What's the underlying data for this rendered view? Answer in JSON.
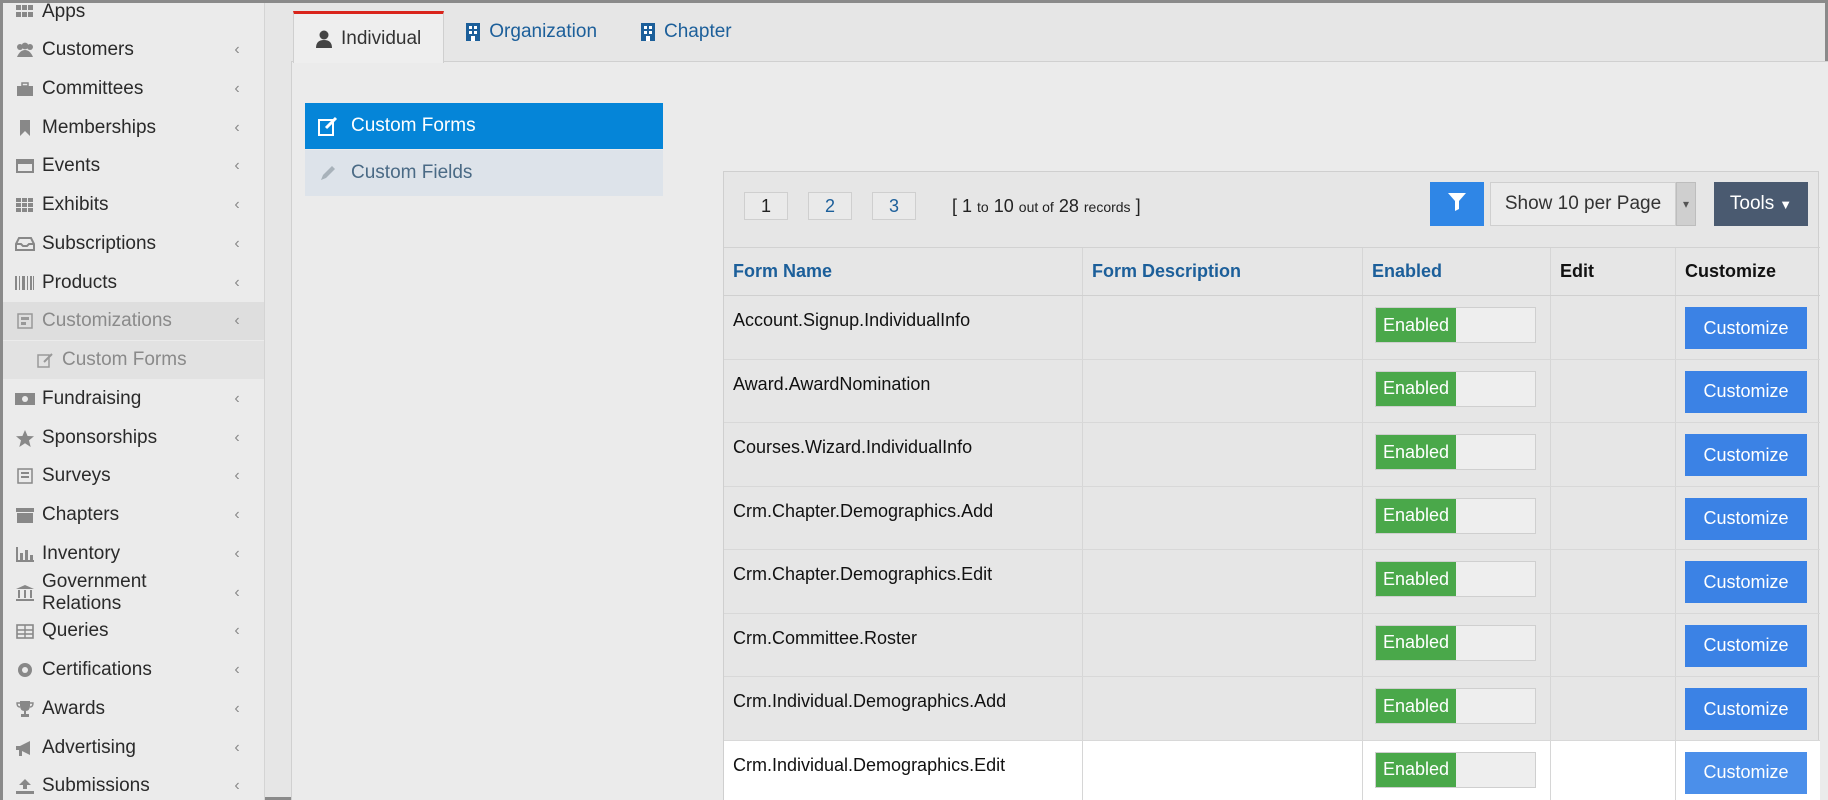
{
  "sidebar": {
    "items": [
      {
        "label": "Apps",
        "icon": "apps-icon"
      },
      {
        "label": "Customers",
        "icon": "users-icon"
      },
      {
        "label": "Committees",
        "icon": "briefcase-icon"
      },
      {
        "label": "Memberships",
        "icon": "bookmark-icon"
      },
      {
        "label": "Events",
        "icon": "calendar-icon"
      },
      {
        "label": "Exhibits",
        "icon": "grid-icon"
      },
      {
        "label": "Subscriptions",
        "icon": "inbox-icon"
      },
      {
        "label": "Products",
        "icon": "barcode-icon"
      },
      {
        "label": "Customizations",
        "icon": "layout-icon"
      },
      {
        "label": "Custom Forms",
        "icon": "edit-icon"
      },
      {
        "label": "Fundraising",
        "icon": "money-icon"
      },
      {
        "label": "Sponsorships",
        "icon": "star-icon"
      },
      {
        "label": "Surveys",
        "icon": "list-icon"
      },
      {
        "label": "Chapters",
        "icon": "archive-icon"
      },
      {
        "label": "Inventory",
        "icon": "bar-chart-icon"
      },
      {
        "label": "Government Relations",
        "icon": "bank-icon"
      },
      {
        "label": "Queries",
        "icon": "table-icon"
      },
      {
        "label": "Certifications",
        "icon": "certificate-icon"
      },
      {
        "label": "Awards",
        "icon": "trophy-icon"
      },
      {
        "label": "Advertising",
        "icon": "bullhorn-icon"
      },
      {
        "label": "Submissions",
        "icon": "upload-icon"
      }
    ]
  },
  "tabs": [
    {
      "label": "Individual",
      "icon": "user-icon"
    },
    {
      "label": "Organization",
      "icon": "building-icon"
    },
    {
      "label": "Chapter",
      "icon": "building-icon"
    }
  ],
  "submenu": [
    {
      "label": "Custom Forms",
      "icon": "edit-icon"
    },
    {
      "label": "Custom Fields",
      "icon": "pencil-icon"
    }
  ],
  "pagination": {
    "pages": [
      "1",
      "2",
      "3"
    ],
    "records_open": "[ 1",
    "records_to": "to",
    "records_end": "10",
    "records_outof": "out of",
    "records_total": "28",
    "records_word": "records",
    "records_close": "]"
  },
  "toolbar": {
    "per_page": "Show 10 per Page",
    "tools": "Tools"
  },
  "table": {
    "headers": [
      "Form Name",
      "Form Description",
      "Enabled",
      "Edit",
      "Customize"
    ],
    "enabled_label": "Enabled",
    "customize_label": "Customize",
    "rows": [
      {
        "name": "Account.Signup.IndividualInfo",
        "description": ""
      },
      {
        "name": "Award.AwardNomination",
        "description": ""
      },
      {
        "name": "Courses.Wizard.IndividualInfo",
        "description": ""
      },
      {
        "name": "Crm.Chapter.Demographics.Add",
        "description": ""
      },
      {
        "name": "Crm.Chapter.Demographics.Edit",
        "description": ""
      },
      {
        "name": "Crm.Committee.Roster",
        "description": ""
      },
      {
        "name": "Crm.Individual.Demographics.Add",
        "description": ""
      },
      {
        "name": "Crm.Individual.Demographics.Edit",
        "description": ""
      }
    ]
  },
  "colors": {
    "accent": "#0585d8",
    "enabled_green": "#4aa84a",
    "customize_blue": "#3b82e5",
    "tools_gray": "#4a5a70",
    "active_tab_border": "#d9241b"
  }
}
